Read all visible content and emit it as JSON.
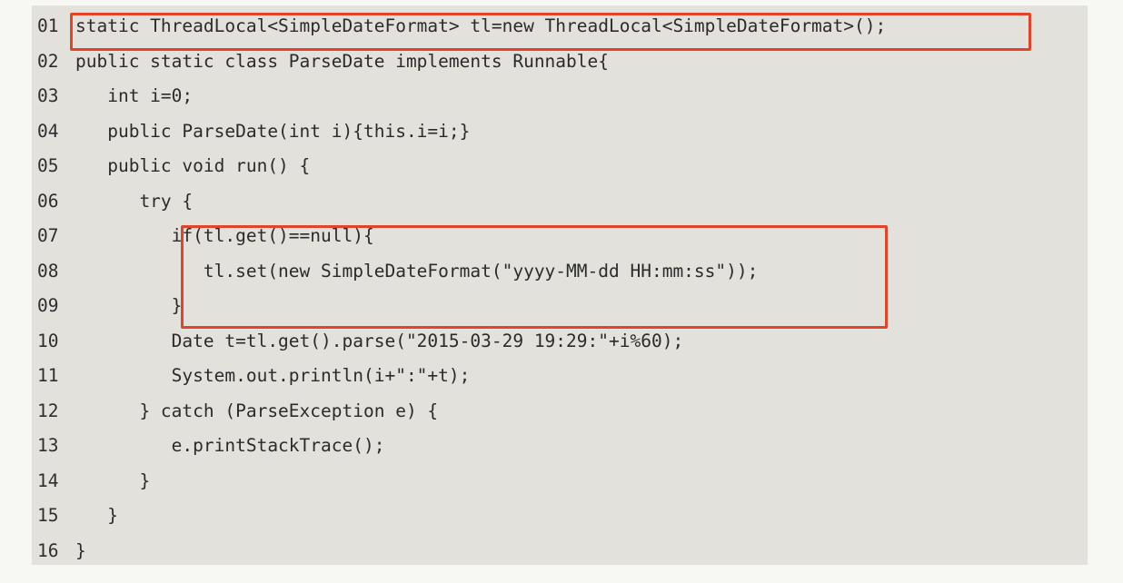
{
  "code": {
    "lines": [
      {
        "number": "01",
        "text": "static ThreadLocal<SimpleDateFormat> tl=new ThreadLocal<SimpleDateFormat>();"
      },
      {
        "number": "02",
        "text": "public static class ParseDate implements Runnable{"
      },
      {
        "number": "03",
        "text": "   int i=0;"
      },
      {
        "number": "04",
        "text": "   public ParseDate(int i){this.i=i;}"
      },
      {
        "number": "05",
        "text": "   public void run() {"
      },
      {
        "number": "06",
        "text": "      try {"
      },
      {
        "number": "07",
        "text": "         if(tl.get()==null){"
      },
      {
        "number": "08",
        "text": "            tl.set(new SimpleDateFormat(\"yyyy-MM-dd HH:mm:ss\"));"
      },
      {
        "number": "09",
        "text": "         }"
      },
      {
        "number": "10",
        "text": "         Date t=tl.get().parse(\"2015-03-29 19:29:\"+i%60);"
      },
      {
        "number": "11",
        "text": "         System.out.println(i+\":\"+t);"
      },
      {
        "number": "12",
        "text": "      } catch (ParseException e) {"
      },
      {
        "number": "13",
        "text": "         e.printStackTrace();"
      },
      {
        "number": "14",
        "text": "      }"
      },
      {
        "number": "15",
        "text": "   }"
      },
      {
        "number": "16",
        "text": "}"
      }
    ]
  },
  "colors": {
    "highlight_border": "#e2432b",
    "panel_background": "#e2e1dc",
    "page_background": "#f7f7f4",
    "text": "#2b2b2b"
  }
}
